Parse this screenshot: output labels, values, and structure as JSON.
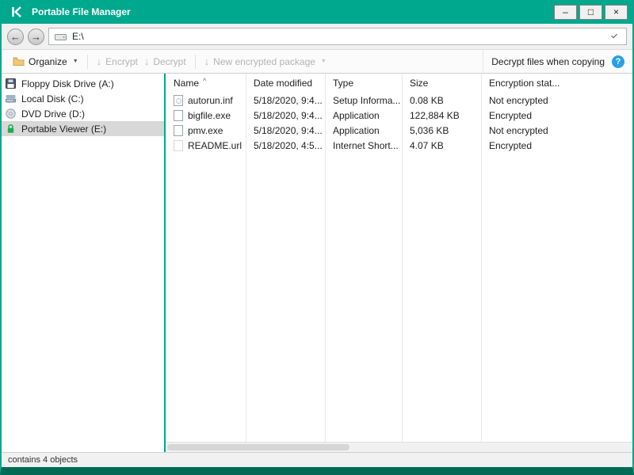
{
  "titlebar": {
    "title": "Portable File Manager"
  },
  "icons": {
    "minimize": "–",
    "maximize": "□",
    "close": "×",
    "back": "←",
    "forward": "→",
    "dropdown": "▼",
    "down_arrow": "↓",
    "sort_asc": "^",
    "help": "?"
  },
  "navbar": {
    "address": "E:\\"
  },
  "toolbar": {
    "organize": "Organize",
    "encrypt": "Encrypt",
    "decrypt": "Decrypt",
    "new_package": "New encrypted package",
    "decrypt_when_copying": "Decrypt files when copying"
  },
  "sidebar": {
    "items": [
      {
        "label": "Floppy Disk Drive (A:)",
        "icon": "floppy-drive-icon",
        "selected": false
      },
      {
        "label": "Local Disk (C:)",
        "icon": "local-disk-icon",
        "selected": false
      },
      {
        "label": "DVD Drive (D:)",
        "icon": "dvd-drive-icon",
        "selected": false
      },
      {
        "label": "Portable Viewer (E:)",
        "icon": "lock-icon",
        "selected": true
      }
    ]
  },
  "filelist": {
    "columns": [
      "Name",
      "Date modified",
      "Type",
      "Size",
      "Encryption stat..."
    ],
    "rows": [
      {
        "name": "autorun.inf",
        "icon": "setup",
        "date": "5/18/2020, 9:4...",
        "type": "Setup Informa...",
        "size": "0.08 KB",
        "encryption": "Not encrypted"
      },
      {
        "name": "bigfile.exe",
        "icon": "file",
        "date": "5/18/2020, 9:4...",
        "type": "Application",
        "size": "122,884 KB",
        "encryption": "Encrypted"
      },
      {
        "name": "pmv.exe",
        "icon": "file",
        "date": "5/18/2020, 9:4...",
        "type": "Application",
        "size": "5,036 KB",
        "encryption": "Not encrypted"
      },
      {
        "name": "README.url",
        "icon": "url",
        "date": "5/18/2020, 4:5...",
        "type": "Internet Short...",
        "size": "4.07 KB",
        "encryption": "Encrypted"
      }
    ]
  },
  "statusbar": {
    "text": "contains 4 objects"
  }
}
